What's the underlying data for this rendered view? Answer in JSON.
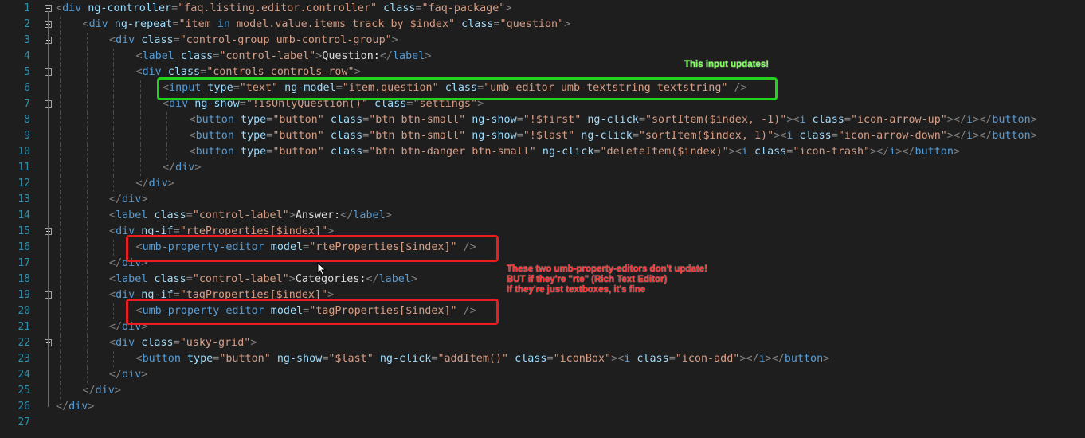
{
  "lines": [
    {
      "n": "1",
      "indent": 0,
      "fold": true,
      "tokens": [
        [
          "p",
          "<"
        ],
        [
          "t",
          "div"
        ],
        [
          "a",
          " ng-controller"
        ],
        [
          "p",
          "="
        ],
        [
          "v",
          "\"faq.listing.editor.controller\""
        ],
        [
          "a",
          " class"
        ],
        [
          "p",
          "="
        ],
        [
          "v",
          "\"faq-package\""
        ],
        [
          "p",
          ">"
        ]
      ]
    },
    {
      "n": "2",
      "indent": 1,
      "fold": true,
      "tokens": [
        [
          "p",
          "<"
        ],
        [
          "t",
          "div"
        ],
        [
          "a",
          " ng-repeat"
        ],
        [
          "p",
          "="
        ],
        [
          "v",
          "\"item "
        ],
        [
          "vx",
          "in"
        ],
        [
          "v",
          " model.value.items track by $index\""
        ],
        [
          "a",
          " class"
        ],
        [
          "p",
          "="
        ],
        [
          "v",
          "\"question\""
        ],
        [
          "p",
          ">"
        ]
      ]
    },
    {
      "n": "3",
      "indent": 2,
      "fold": true,
      "tokens": [
        [
          "p",
          "<"
        ],
        [
          "t",
          "div"
        ],
        [
          "a",
          " class"
        ],
        [
          "p",
          "="
        ],
        [
          "v",
          "\"control-group umb-control-group\""
        ],
        [
          "p",
          ">"
        ]
      ]
    },
    {
      "n": "4",
      "indent": 3,
      "fold": false,
      "tokens": [
        [
          "p",
          "<"
        ],
        [
          "t",
          "label"
        ],
        [
          "a",
          " class"
        ],
        [
          "p",
          "="
        ],
        [
          "v",
          "\"control-label\""
        ],
        [
          "p",
          ">"
        ],
        [
          "txt",
          "Question:"
        ],
        [
          "p",
          "</"
        ],
        [
          "t",
          "label"
        ],
        [
          "p",
          ">"
        ]
      ]
    },
    {
      "n": "5",
      "indent": 3,
      "fold": true,
      "tokens": [
        [
          "p",
          "<"
        ],
        [
          "t",
          "div"
        ],
        [
          "a",
          " class"
        ],
        [
          "p",
          "="
        ],
        [
          "v",
          "\"controls controls-row\""
        ],
        [
          "p",
          ">"
        ]
      ]
    },
    {
      "n": "6",
      "indent": 4,
      "fold": false,
      "tokens": [
        [
          "p",
          "<"
        ],
        [
          "t",
          "input"
        ],
        [
          "a",
          " type"
        ],
        [
          "p",
          "="
        ],
        [
          "v",
          "\"text\""
        ],
        [
          "a",
          " ng-model"
        ],
        [
          "p",
          "="
        ],
        [
          "v",
          "\"item.question\""
        ],
        [
          "a",
          " class"
        ],
        [
          "p",
          "="
        ],
        [
          "v",
          "\"umb-editor umb-textstring textstring\""
        ],
        [
          "p",
          " />"
        ]
      ]
    },
    {
      "n": "7",
      "indent": 4,
      "fold": true,
      "tokens": [
        [
          "p",
          "<"
        ],
        [
          "t",
          "div"
        ],
        [
          "a",
          " ng-show"
        ],
        [
          "p",
          "="
        ],
        [
          "v",
          "\"!isOnlyQuestion()\""
        ],
        [
          "a",
          " class"
        ],
        [
          "p",
          "="
        ],
        [
          "v",
          "\"settings\""
        ],
        [
          "p",
          ">"
        ]
      ]
    },
    {
      "n": "8",
      "indent": 5,
      "fold": false,
      "tokens": [
        [
          "p",
          "<"
        ],
        [
          "t",
          "button"
        ],
        [
          "a",
          " type"
        ],
        [
          "p",
          "="
        ],
        [
          "v",
          "\"button\""
        ],
        [
          "a",
          " class"
        ],
        [
          "p",
          "="
        ],
        [
          "v",
          "\"btn btn-small\""
        ],
        [
          "a",
          " ng-show"
        ],
        [
          "p",
          "="
        ],
        [
          "v",
          "\"!$first\""
        ],
        [
          "a",
          " ng-click"
        ],
        [
          "p",
          "="
        ],
        [
          "v",
          "\"sortItem($index, -1)\""
        ],
        [
          "p",
          ">"
        ],
        [
          "p",
          "<"
        ],
        [
          "t",
          "i"
        ],
        [
          "a",
          " class"
        ],
        [
          "p",
          "="
        ],
        [
          "v",
          "\"icon-arrow-up\""
        ],
        [
          "p",
          ">"
        ],
        [
          "p",
          "</"
        ],
        [
          "t",
          "i"
        ],
        [
          "p",
          ">"
        ],
        [
          "p",
          "</"
        ],
        [
          "t",
          "button"
        ],
        [
          "p",
          ">"
        ]
      ]
    },
    {
      "n": "9",
      "indent": 5,
      "fold": false,
      "tokens": [
        [
          "p",
          "<"
        ],
        [
          "t",
          "button"
        ],
        [
          "a",
          " type"
        ],
        [
          "p",
          "="
        ],
        [
          "v",
          "\"button\""
        ],
        [
          "a",
          " class"
        ],
        [
          "p",
          "="
        ],
        [
          "v",
          "\"btn btn-small\""
        ],
        [
          "a",
          " ng-show"
        ],
        [
          "p",
          "="
        ],
        [
          "v",
          "\"!$last\""
        ],
        [
          "a",
          " ng-click"
        ],
        [
          "p",
          "="
        ],
        [
          "v",
          "\"sortItem($index, 1)\""
        ],
        [
          "p",
          ">"
        ],
        [
          "p",
          "<"
        ],
        [
          "t",
          "i"
        ],
        [
          "a",
          " class"
        ],
        [
          "p",
          "="
        ],
        [
          "v",
          "\"icon-arrow-down\""
        ],
        [
          "p",
          ">"
        ],
        [
          "p",
          "</"
        ],
        [
          "t",
          "i"
        ],
        [
          "p",
          ">"
        ],
        [
          "p",
          "</"
        ],
        [
          "t",
          "button"
        ],
        [
          "p",
          ">"
        ]
      ]
    },
    {
      "n": "10",
      "indent": 5,
      "fold": false,
      "tokens": [
        [
          "p",
          "<"
        ],
        [
          "t",
          "button"
        ],
        [
          "a",
          " type"
        ],
        [
          "p",
          "="
        ],
        [
          "v",
          "\"button\""
        ],
        [
          "a",
          " class"
        ],
        [
          "p",
          "="
        ],
        [
          "v",
          "\"btn btn-danger btn-small\""
        ],
        [
          "a",
          " ng-click"
        ],
        [
          "p",
          "="
        ],
        [
          "v",
          "\"deleteItem($index)\""
        ],
        [
          "p",
          ">"
        ],
        [
          "p",
          "<"
        ],
        [
          "t",
          "i"
        ],
        [
          "a",
          " class"
        ],
        [
          "p",
          "="
        ],
        [
          "v",
          "\"icon-trash\""
        ],
        [
          "p",
          ">"
        ],
        [
          "p",
          "</"
        ],
        [
          "t",
          "i"
        ],
        [
          "p",
          ">"
        ],
        [
          "p",
          "</"
        ],
        [
          "t",
          "button"
        ],
        [
          "p",
          ">"
        ]
      ]
    },
    {
      "n": "11",
      "indent": 4,
      "fold": false,
      "tokens": [
        [
          "p",
          "</"
        ],
        [
          "t",
          "div"
        ],
        [
          "p",
          ">"
        ]
      ]
    },
    {
      "n": "12",
      "indent": 3,
      "fold": false,
      "tokens": [
        [
          "p",
          "</"
        ],
        [
          "t",
          "div"
        ],
        [
          "p",
          ">"
        ]
      ]
    },
    {
      "n": "13",
      "indent": 2,
      "fold": false,
      "tokens": [
        [
          "p",
          "</"
        ],
        [
          "t",
          "div"
        ],
        [
          "p",
          ">"
        ]
      ]
    },
    {
      "n": "14",
      "indent": 2,
      "fold": false,
      "tokens": [
        [
          "p",
          "<"
        ],
        [
          "t",
          "label"
        ],
        [
          "a",
          " class"
        ],
        [
          "p",
          "="
        ],
        [
          "v",
          "\"control-label\""
        ],
        [
          "p",
          ">"
        ],
        [
          "txt",
          "Answer:"
        ],
        [
          "p",
          "</"
        ],
        [
          "t",
          "label"
        ],
        [
          "p",
          ">"
        ]
      ]
    },
    {
      "n": "15",
      "indent": 2,
      "fold": true,
      "tokens": [
        [
          "p",
          "<"
        ],
        [
          "t",
          "div"
        ],
        [
          "a",
          " ng-if"
        ],
        [
          "p",
          "="
        ],
        [
          "v",
          "\"rteProperties[$index]\""
        ],
        [
          "p",
          ">"
        ]
      ]
    },
    {
      "n": "16",
      "indent": 3,
      "fold": false,
      "tokens": [
        [
          "p",
          "<"
        ],
        [
          "t",
          "umb-property-editor"
        ],
        [
          "a",
          " model"
        ],
        [
          "p",
          "="
        ],
        [
          "v",
          "\"rteProperties[$index]\""
        ],
        [
          "p",
          " />"
        ]
      ]
    },
    {
      "n": "17",
      "indent": 2,
      "fold": false,
      "tokens": [
        [
          "p",
          "</"
        ],
        [
          "t",
          "div"
        ],
        [
          "p",
          ">"
        ]
      ]
    },
    {
      "n": "18",
      "indent": 2,
      "fold": false,
      "tokens": [
        [
          "p",
          "<"
        ],
        [
          "t",
          "label"
        ],
        [
          "a",
          " class"
        ],
        [
          "p",
          "="
        ],
        [
          "v",
          "\"control-label\""
        ],
        [
          "p",
          ">"
        ],
        [
          "txt",
          "Categories:"
        ],
        [
          "p",
          "</"
        ],
        [
          "t",
          "label"
        ],
        [
          "p",
          ">"
        ]
      ]
    },
    {
      "n": "19",
      "indent": 2,
      "fold": true,
      "tokens": [
        [
          "p",
          "<"
        ],
        [
          "t",
          "div"
        ],
        [
          "a",
          " ng-if"
        ],
        [
          "p",
          "="
        ],
        [
          "v",
          "\"tagProperties[$index]\""
        ],
        [
          "p",
          ">"
        ]
      ]
    },
    {
      "n": "20",
      "indent": 3,
      "fold": false,
      "tokens": [
        [
          "p",
          "<"
        ],
        [
          "t",
          "umb-property-editor"
        ],
        [
          "a",
          " model"
        ],
        [
          "p",
          "="
        ],
        [
          "v",
          "\"tagProperties[$index]\""
        ],
        [
          "p",
          " />"
        ]
      ]
    },
    {
      "n": "21",
      "indent": 2,
      "fold": false,
      "tokens": [
        [
          "p",
          "</"
        ],
        [
          "t",
          "div"
        ],
        [
          "p",
          ">"
        ]
      ]
    },
    {
      "n": "22",
      "indent": 2,
      "fold": true,
      "tokens": [
        [
          "p",
          "<"
        ],
        [
          "t",
          "div"
        ],
        [
          "a",
          " class"
        ],
        [
          "p",
          "="
        ],
        [
          "v",
          "\"usky-grid\""
        ],
        [
          "p",
          ">"
        ]
      ]
    },
    {
      "n": "23",
      "indent": 3,
      "fold": false,
      "tokens": [
        [
          "p",
          "<"
        ],
        [
          "t",
          "button"
        ],
        [
          "a",
          " type"
        ],
        [
          "p",
          "="
        ],
        [
          "v",
          "\"button\""
        ],
        [
          "a",
          " ng-show"
        ],
        [
          "p",
          "="
        ],
        [
          "v",
          "\"$last\""
        ],
        [
          "a",
          " ng-click"
        ],
        [
          "p",
          "="
        ],
        [
          "v",
          "\"addItem()\""
        ],
        [
          "a",
          " class"
        ],
        [
          "p",
          "="
        ],
        [
          "v",
          "\"iconBox\""
        ],
        [
          "p",
          ">"
        ],
        [
          "p",
          "<"
        ],
        [
          "t",
          "i"
        ],
        [
          "a",
          " class"
        ],
        [
          "p",
          "="
        ],
        [
          "v",
          "\"icon-add\""
        ],
        [
          "p",
          ">"
        ],
        [
          "p",
          "</"
        ],
        [
          "t",
          "i"
        ],
        [
          "p",
          ">"
        ],
        [
          "p",
          "</"
        ],
        [
          "t",
          "button"
        ],
        [
          "p",
          ">"
        ]
      ]
    },
    {
      "n": "24",
      "indent": 2,
      "fold": false,
      "tokens": [
        [
          "p",
          "</"
        ],
        [
          "t",
          "div"
        ],
        [
          "p",
          ">"
        ]
      ]
    },
    {
      "n": "25",
      "indent": 1,
      "fold": false,
      "tokens": [
        [
          "p",
          "</"
        ],
        [
          "t",
          "div"
        ],
        [
          "p",
          ">"
        ]
      ]
    },
    {
      "n": "26",
      "indent": 0,
      "fold": false,
      "tokens": [
        [
          "p",
          "</"
        ],
        [
          "t",
          "div"
        ],
        [
          "p",
          ">"
        ]
      ]
    },
    {
      "n": "27",
      "indent": 0,
      "fold": false,
      "tokens": []
    }
  ],
  "annotations": {
    "green_note": "This input updates!",
    "red_note_line1": "These two umb-property-editors don't update!",
    "red_note_line2": "BUT if they're \"rte\" (Rich Text Editor)",
    "red_note_line3": "If they're just textboxes, it's fine"
  },
  "colors": {
    "background": "#1e1e1e",
    "line_number": "#2b91af",
    "tag": "#569cd6",
    "attribute": "#9cdcfe",
    "attr_value": "#d69d85",
    "punctuation": "#808080",
    "highlight_green": "#23d21c",
    "highlight_red": "#ec1c24"
  }
}
